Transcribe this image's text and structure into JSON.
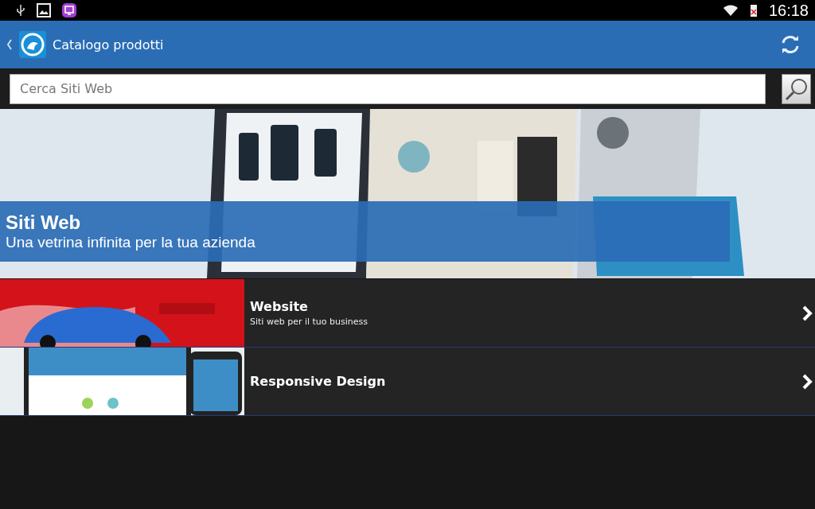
{
  "status_bar": {
    "time": "16:18"
  },
  "app_bar": {
    "title": "Catalogo prodotti"
  },
  "search": {
    "placeholder": "Cerca Siti Web"
  },
  "banner": {
    "title": "Siti Web",
    "subtitle": "Una vetrina infinita per la tua azienda"
  },
  "items": [
    {
      "title": "Website",
      "subtitle": "Siti web per il tuo business"
    },
    {
      "title": "Responsive Design"
    }
  ]
}
